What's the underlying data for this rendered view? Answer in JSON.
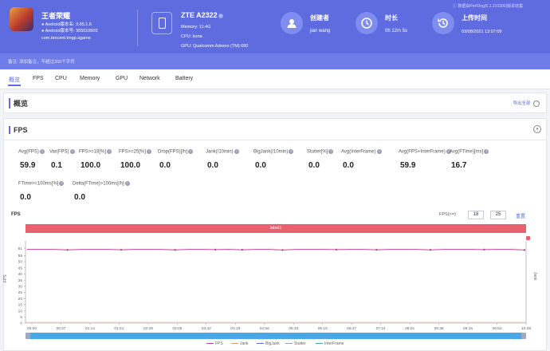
{
  "app": {
    "name": "王者荣耀",
    "android_version": "Android版本名: 3.65.1.6",
    "android_code": "Android版本号: 365010603",
    "package": "com.tencent.tmgp.sgame",
    "note": "备注: 添加备注，不超过200个字符"
  },
  "device": {
    "model": "ZTE A2322",
    "memory": "Memory: 11.4G",
    "cpu": "CPU: kona",
    "gpu": "GPU: Qualcomm Adreno (TM) 650"
  },
  "creator": {
    "label": "创建者",
    "value": "jian wang"
  },
  "duration": {
    "label": "时长",
    "value": "0h 12m 5s"
  },
  "upload": {
    "label": "上传时间",
    "value": "03/08/2021 13:07:09"
  },
  "data_source": "数据由PerfDog(5.1.210300)版本收集",
  "tabs": [
    "概览",
    "FPS",
    "CPU",
    "Memory",
    "GPU",
    "Network",
    "Battery"
  ],
  "overview": {
    "title": "概览",
    "export": "导出全部"
  },
  "fps_section": {
    "title": "FPS",
    "metrics_row1": [
      {
        "label": "Avg(FPS)",
        "value": "59.9"
      },
      {
        "label": "Var(FPS)",
        "value": "0.1"
      },
      {
        "label": "FPS>=18[%]",
        "value": "100.0"
      },
      {
        "label": "FPS>=25[%]",
        "value": "100.0"
      },
      {
        "label": "Drop(FPS)[/h]",
        "value": "0.0"
      },
      {
        "label": "Jank(/10min)",
        "value": "0.0"
      },
      {
        "label": "BigJank(/10min)",
        "value": "0.0"
      },
      {
        "label": "Stutter[%]",
        "value": "0.0"
      },
      {
        "label": "Avg(InterFrame)",
        "value": "0.0"
      },
      {
        "label": "Avg(FPS+InterFrame)",
        "value": "59.9"
      },
      {
        "label": "Avg(FTime)[ms]",
        "value": "16.7"
      }
    ],
    "metrics_row2": [
      {
        "label": "FTime>=100ms[%]",
        "value": "0.0"
      },
      {
        "label": "Delta(FTime)>100ms[/h]",
        "value": "0.0"
      }
    ],
    "chart_label": "FPS",
    "filter_label": "FPS(>=)",
    "filter_low": "18",
    "filter_high": "25",
    "reset": "重置",
    "band_label": "label1",
    "right_axis": "Jank"
  },
  "colors": {
    "accent": "#5e6ce0",
    "fps": "#c2409a",
    "band": "#e8616e",
    "scroll": "#4aa8e8"
  },
  "chart_data": {
    "type": "line",
    "ylabel": "FPS",
    "yticks": [
      0,
      5,
      10,
      15,
      20,
      25,
      30,
      35,
      40,
      45,
      50,
      55,
      61
    ],
    "ylim": [
      0,
      63
    ],
    "xticks": [
      "00:00",
      "00:37",
      "01:14",
      "01:51",
      "02:28",
      "03:05",
      "03:42",
      "04:19",
      "04:56",
      "05:33",
      "06:10",
      "06:47",
      "07:24",
      "08:01",
      "08:38",
      "09:15",
      "09:52",
      "10:29"
    ],
    "series": [
      {
        "name": "FPS",
        "values": [
          60,
          60,
          60,
          59.6,
          60,
          60,
          60,
          59.7,
          60,
          60,
          60,
          59.6,
          60,
          60,
          59.8,
          60,
          59.7,
          60,
          60,
          59.5,
          60,
          60,
          60,
          59.8,
          60,
          60,
          59.7,
          60,
          60,
          60,
          59.6,
          60,
          60,
          60,
          59.8,
          60,
          60,
          59.5
        ]
      },
      {
        "name": "Jank",
        "values": []
      },
      {
        "name": "BigJank",
        "values": []
      },
      {
        "name": "Stutter",
        "values": []
      },
      {
        "name": "InterFrame",
        "values": []
      }
    ]
  }
}
